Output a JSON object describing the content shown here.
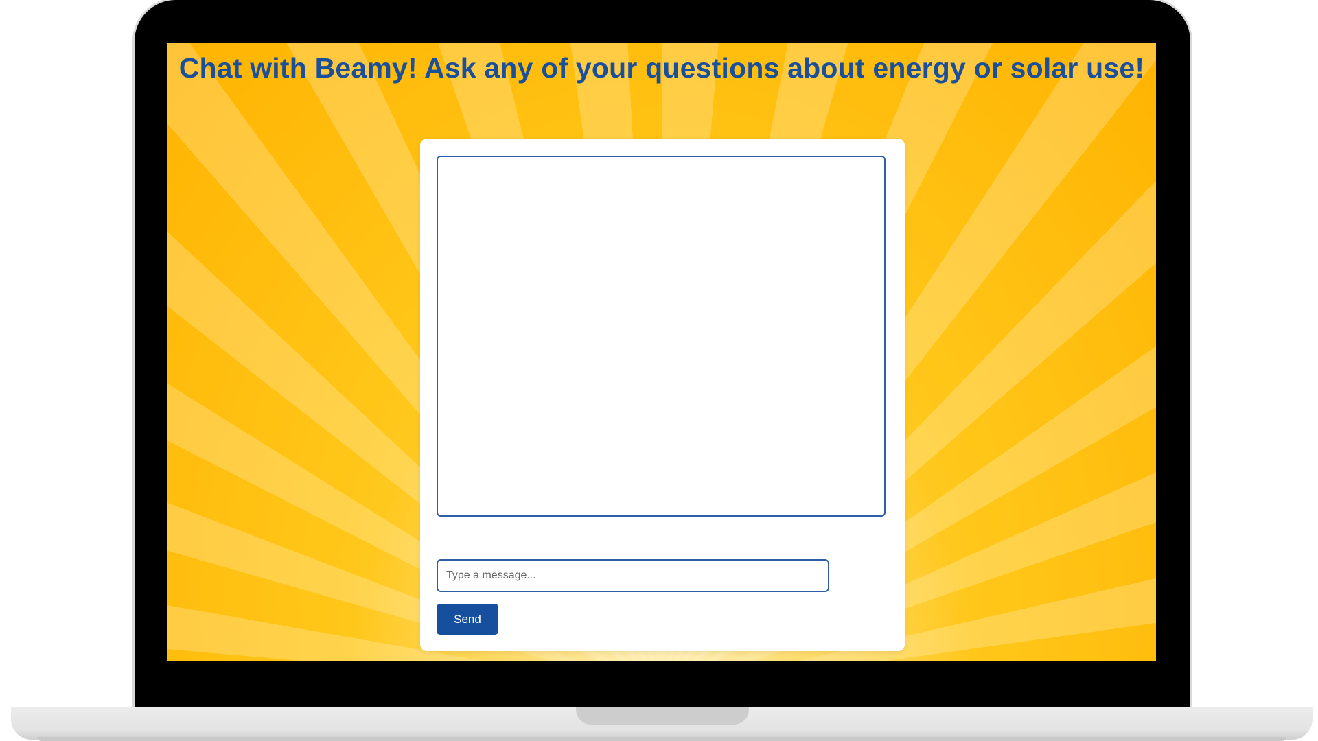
{
  "page": {
    "title": "Chat with Beamy! Ask any of your questions about energy or solar use!"
  },
  "chat": {
    "messages": [],
    "input": {
      "value": "",
      "placeholder": "Type a message..."
    },
    "send_label": "Send"
  },
  "colors": {
    "title": "#1a4f9c",
    "accent": "#154f9e",
    "background": "#ffc107"
  }
}
